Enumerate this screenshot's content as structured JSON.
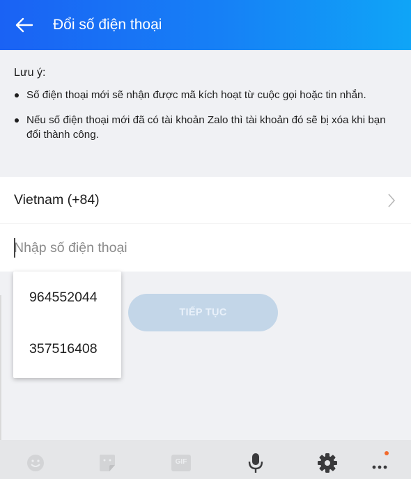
{
  "header": {
    "title": "Đổi số điện thoại"
  },
  "note": {
    "label": "Lưu ý:",
    "items": [
      "Số điện thoại mới sẽ nhận được mã kích hoạt từ cuộc gọi hoặc tin nhắn.",
      "Nếu số điện thoại mới đã có tài khoản Zalo thì tài khoản đó sẽ bị xóa khi bạn đổi thành công."
    ]
  },
  "form": {
    "country": "Vietnam (+84)",
    "phone_placeholder": "Nhập số điện thoại",
    "phone_value": "",
    "continue_label": "TIẾP TỤC"
  },
  "autocomplete": {
    "items": [
      "964552044",
      "357516408"
    ]
  },
  "keyboard_toolbar": {
    "icons": [
      "emoji-icon",
      "sticker-icon",
      "gif-icon",
      "microphone-icon",
      "gear-icon",
      "more-icon"
    ],
    "gif_label": "GIF"
  },
  "colors": {
    "header_start": "#1a62f4",
    "header_end": "#0fa5f7",
    "button_disabled": "#c3d6e8",
    "notification_dot": "#f26a2b"
  }
}
